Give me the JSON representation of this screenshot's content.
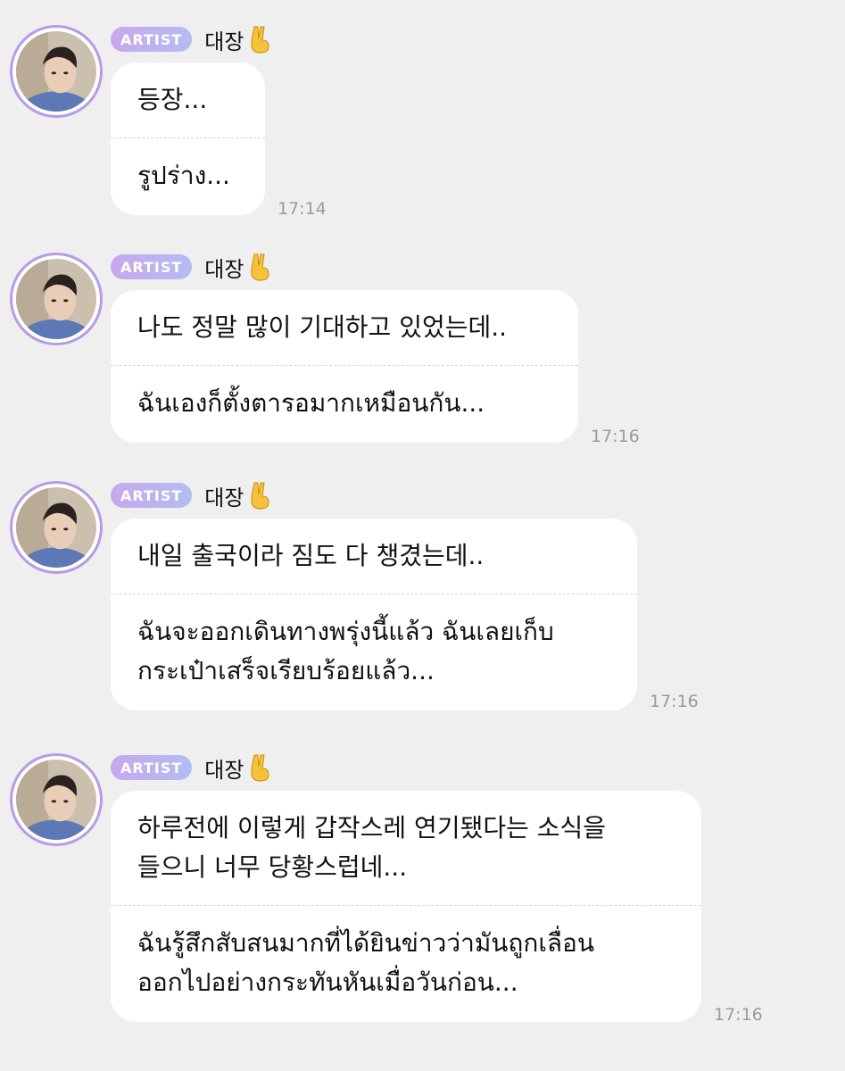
{
  "messages": [
    {
      "badge": "ARTIST",
      "sender": "대장",
      "original": "등장...",
      "translation": "รูปร่าง...",
      "time": "17:14"
    },
    {
      "badge": "ARTIST",
      "sender": "대장",
      "original": "나도 정말 많이 기대하고 있었는데..",
      "translation": "ฉันเองก็ตั้งตารอมากเหมือนกัน...",
      "time": "17:16"
    },
    {
      "badge": "ARTIST",
      "sender": "대장",
      "original": "내일 출국이라 짐도 다 챙겼는데..",
      "translation": "ฉันจะออกเดินทางพรุ่งนี้แล้ว ฉันเลยเก็บ\nกระเป๋าเสร็จเรียบร้อยแล้ว...",
      "time": "17:16"
    },
    {
      "badge": "ARTIST",
      "sender": "대장",
      "original": "하루전에 이렇게 갑작스레 연기됐다는 소식을\n들으니 너무 당황스럽네...",
      "translation": "ฉันรู้สึกสับสนมากที่ได้ยินข่าวว่ามันถูกเลื่อน\nออกไปอย่างกระทันหันเมื่อวันก่อน...",
      "time": "17:16"
    }
  ],
  "icons": {
    "sender_emoji": "victory-hand-icon",
    "avatar": "avatar-photo"
  },
  "colors": {
    "background": "#efefef",
    "bubble": "#ffffff",
    "badge_start": "#c9a7ec",
    "badge_end": "#b3bdf3",
    "avatar_ring": "#b79be6",
    "timestamp": "#9a9a9a"
  }
}
